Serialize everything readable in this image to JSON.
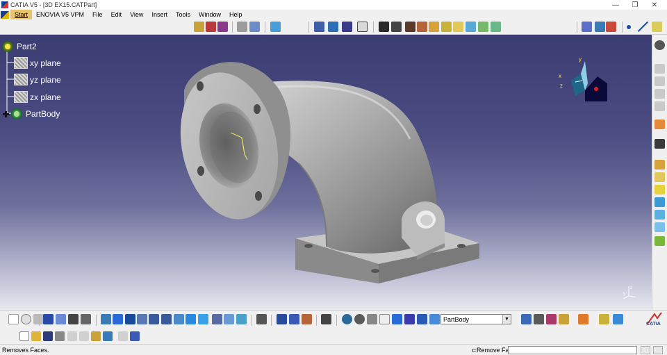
{
  "window": {
    "app": "CATIA V5",
    "document": "[3D EX15.CATPart]"
  },
  "menu": [
    {
      "name": "menu-start",
      "label": "Start"
    },
    {
      "name": "menu-enovia",
      "label": "ENOVIA V5 VPM"
    },
    {
      "name": "menu-file",
      "label": "File"
    },
    {
      "name": "menu-edit",
      "label": "Edit"
    },
    {
      "name": "menu-view",
      "label": "View"
    },
    {
      "name": "menu-insert",
      "label": "Insert"
    },
    {
      "name": "menu-tools",
      "label": "Tools"
    },
    {
      "name": "menu-window",
      "label": "Window"
    },
    {
      "name": "menu-help",
      "label": "Help"
    }
  ],
  "tree": {
    "root": "Part2",
    "items": [
      {
        "label": "xy plane",
        "icon": "plane-icon"
      },
      {
        "label": "yz plane",
        "icon": "plane-icon"
      },
      {
        "label": "zx plane",
        "icon": "plane-icon"
      },
      {
        "label": "PartBody",
        "icon": "body-icon"
      }
    ]
  },
  "compass": {
    "x": "x",
    "y": "y",
    "z": "z"
  },
  "toolbar": {
    "body_selector": "PartBody"
  },
  "status": {
    "message": "Removes Faces.",
    "command_label": "c:Remove Face",
    "command_value": ""
  },
  "colors": {
    "background_top": "#3b3d72",
    "background_bottom": "#e7e7ef",
    "model_gray": "#b5b5b5",
    "accent": "#e9c46a"
  }
}
